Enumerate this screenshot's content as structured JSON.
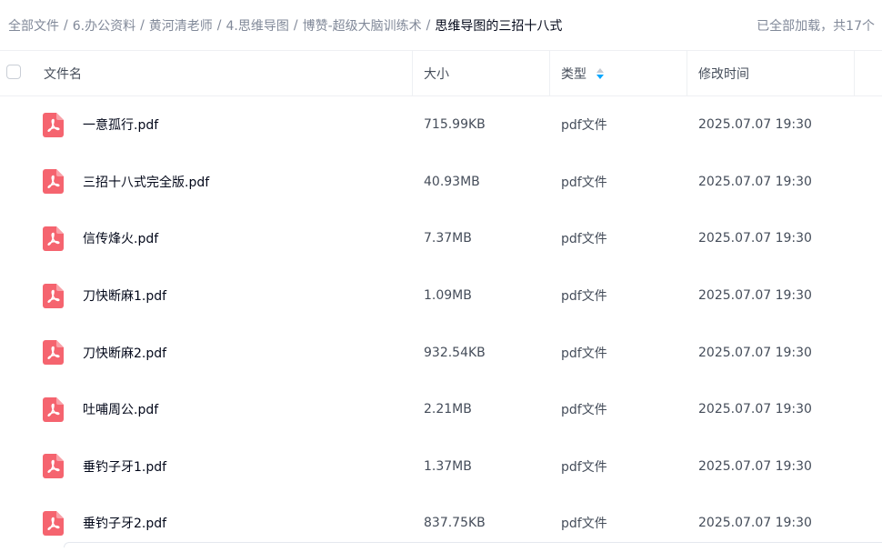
{
  "breadcrumb": [
    {
      "label": "全部文件"
    },
    {
      "label": "6.办公资料"
    },
    {
      "label": "黄河清老师"
    },
    {
      "label": "4.思维导图"
    },
    {
      "label": "博赞-超级大脑训练术"
    },
    {
      "label": "思维导图的三招十八式"
    }
  ],
  "breadcrumb_separator": "/",
  "loaded_info": "已全部加载，共17个",
  "table": {
    "columns": {
      "name": "文件名",
      "size": "大小",
      "type": "类型",
      "modified": "修改时间"
    },
    "sorted_by": "type",
    "rows": [
      {
        "name": "一意孤行.pdf",
        "size": "715.99KB",
        "type": "pdf文件",
        "modified": "2025.07.07 19:30",
        "icon": "pdf-file-icon"
      },
      {
        "name": "三招十八式完全版.pdf",
        "size": "40.93MB",
        "type": "pdf文件",
        "modified": "2025.07.07 19:30",
        "icon": "pdf-file-icon"
      },
      {
        "name": "信传烽火.pdf",
        "size": "7.37MB",
        "type": "pdf文件",
        "modified": "2025.07.07 19:30",
        "icon": "pdf-file-icon"
      },
      {
        "name": "刀快断麻1.pdf",
        "size": "1.09MB",
        "type": "pdf文件",
        "modified": "2025.07.07 19:30",
        "icon": "pdf-file-icon"
      },
      {
        "name": "刀快断麻2.pdf",
        "size": "932.54KB",
        "type": "pdf文件",
        "modified": "2025.07.07 19:30",
        "icon": "pdf-file-icon"
      },
      {
        "name": "吐哺周公.pdf",
        "size": "2.21MB",
        "type": "pdf文件",
        "modified": "2025.07.07 19:30",
        "icon": "pdf-file-icon"
      },
      {
        "name": "垂钓子牙1.pdf",
        "size": "1.37MB",
        "type": "pdf文件",
        "modified": "2025.07.07 19:30",
        "icon": "pdf-file-icon"
      },
      {
        "name": "垂钓子牙2.pdf",
        "size": "837.75KB",
        "type": "pdf文件",
        "modified": "2025.07.07 19:30",
        "icon": "pdf-file-icon"
      }
    ]
  },
  "colors": {
    "pdf_icon": "#f5646f",
    "sort_active": "#06a7ff",
    "sort_inactive": "#c4c9d2"
  }
}
